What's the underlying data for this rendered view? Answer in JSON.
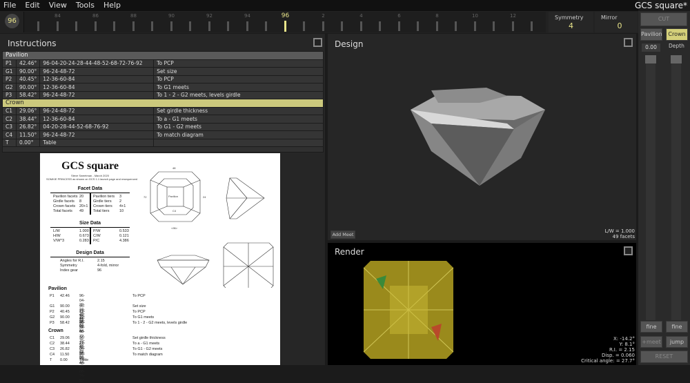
{
  "app": {
    "title": "GCS square*"
  },
  "menu": [
    "File",
    "Edit",
    "View",
    "Tools",
    "Help"
  ],
  "toolbar": {
    "index_gear": "96",
    "ruler_labels": [
      "84",
      "86",
      "88",
      "90",
      "92",
      "94",
      "96",
      "2",
      "4",
      "6",
      "8",
      "10",
      "12"
    ],
    "selected": "96",
    "symmetry_label": "Symmetry",
    "symmetry_value": "4",
    "mirror_label": "Mirror",
    "mirror_value": "0"
  },
  "side": {
    "cut": "CUT",
    "pavilion": "Pavilion",
    "crown": "Crown",
    "depth_value": "0.00",
    "depth_label": "Depth",
    "fine1": "fine",
    "fine2": "fine",
    "meet": "+meet",
    "jump": "jump",
    "reset": "RESET"
  },
  "instructions": {
    "title": "Instructions",
    "sections": [
      {
        "name": "Pavilion",
        "rows": [
          [
            "P1",
            "42.46°",
            "96-04-20-24-28-44-48-52-68-72-76-92",
            "To PCP"
          ],
          [
            "G1",
            "90.00°",
            "96-24-48-72",
            "Set size"
          ],
          [
            "P2",
            "40.45°",
            "12-36-60-84",
            "To PCP"
          ],
          [
            "G2",
            "90.00°",
            "12-36-60-84",
            "To G1 meets"
          ],
          [
            "P3",
            "58.42°",
            "96-24-48-72",
            "To 1 - 2 - G2 meets, levels girdle"
          ]
        ]
      },
      {
        "name": "Crown",
        "rows": [
          [
            "C1",
            "29.06°",
            "96-24-48-72",
            "Set girdle thickness"
          ],
          [
            "C2",
            "38.44°",
            "12-36-60-84",
            "To a - G1 meets"
          ],
          [
            "C3",
            "26.82°",
            "04-20-28-44-52-68-76-92",
            "To G1 - G2 meets"
          ],
          [
            "C4",
            "11.50°",
            "96-24-48-72",
            "To match diagram"
          ],
          [
            "T",
            "0.00°",
            "Table",
            ""
          ]
        ]
      }
    ]
  },
  "document": {
    "title": "GCS square",
    "author": "Steve Sweetman - March 2020",
    "subtitle": "SOMKIE PRINCESS as shown on GCS 1.1 launch page and resequenced",
    "facet_heading": "Facet Data",
    "facet_left": [
      [
        "Pavilion facets",
        "20"
      ],
      [
        "Girdle facets",
        "8"
      ],
      [
        "Crown facets",
        "20+1"
      ],
      [
        "Total facets",
        "49"
      ]
    ],
    "facet_right": [
      [
        "Pavilion tiers",
        "3"
      ],
      [
        "Girdle tiers",
        "2"
      ],
      [
        "Crown tiers",
        "4+1"
      ],
      [
        "Total tiers",
        "10"
      ]
    ],
    "size_heading": "Size Data",
    "size_left": [
      [
        "L/W",
        "1.000"
      ],
      [
        "H/W",
        "0.673"
      ],
      [
        "V/W^3",
        "0.283"
      ]
    ],
    "size_right": [
      [
        "P/W",
        "0.533"
      ],
      [
        "C/W",
        "0.121"
      ],
      [
        "P/C",
        "4.386"
      ]
    ],
    "design_heading": "Design Data",
    "design": [
      [
        "Angles for R.I.",
        "2.15"
      ],
      [
        "Symmetry",
        "4-fold, mirror"
      ],
      [
        "Index gear",
        "96"
      ]
    ],
    "pavilion_heading": "Pavilion",
    "pavilion": [
      [
        "P1",
        "42.46",
        "96-04-20-24-28-44-48-52-68-72-76-92",
        "To PCP"
      ],
      [
        "G1",
        "90.00",
        "96-24-48-72",
        "Set size"
      ],
      [
        "P2",
        "40.45",
        "12-36-60-84",
        "To PCP"
      ],
      [
        "G2",
        "90.00",
        "12-36-60-84",
        "To G1 meets"
      ],
      [
        "P3",
        "58.42",
        "96-24-48-72",
        "To 1 - 2 - G2 meets, levels girdle"
      ]
    ],
    "crown_heading": "Crown",
    "crown": [
      [
        "C1",
        "29.06",
        "96-24-48-72",
        "Set girdle thickness"
      ],
      [
        "C2",
        "38.44",
        "12-36-60-84",
        "To a - G1 meets"
      ],
      [
        "C3",
        "26.82",
        "04-20-28-44-52-68-76-92",
        "To G1 - G2 meets"
      ],
      [
        "C4",
        "11.50",
        "96-24-48-72",
        "To match diagram"
      ],
      [
        "T",
        "0.00",
        "Table",
        ""
      ]
    ],
    "diagram_labels": {
      "top": "48",
      "bottom": "<96>",
      "left": "72",
      "right": "24",
      "pav": "Pavilion",
      "crown": "C4",
      "g1": "G1",
      "l": "L"
    }
  },
  "design": {
    "title": "Design",
    "add_meet": "Add Meet",
    "lw": "L/W = 1.000",
    "facets": "49 facets"
  },
  "render": {
    "title": "Render",
    "x": "X: -14.2°",
    "y": "Y: 8.1°",
    "ri": "R.I. = 2.15",
    "disp": "Disp. = 0.060",
    "critical": "Critical angle: = 27.7°"
  }
}
